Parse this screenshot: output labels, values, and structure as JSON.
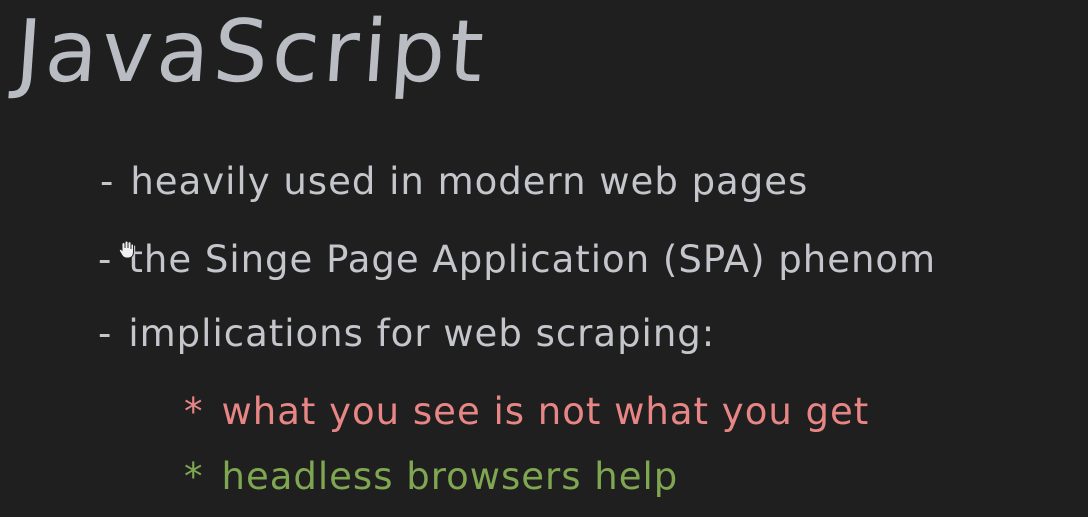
{
  "slide": {
    "title": "JavaScript",
    "bullets": [
      {
        "marker": "-",
        "text": "heavily used in modern web pages"
      },
      {
        "marker": "-",
        "text": "the Singe Page Application (SPA) phenom"
      },
      {
        "marker": "-",
        "text": "implications for web scraping:"
      }
    ],
    "sub_bullets": [
      {
        "marker": "*",
        "text": "what you see is not what you get",
        "color": "#e88585"
      },
      {
        "marker": "*",
        "text": "headless browsers help",
        "color": "#7fa651"
      }
    ]
  },
  "colors": {
    "background": "#1f1f1f",
    "title": "#b9bcc2",
    "bullet_text": "#c4c6cc"
  },
  "cursor": {
    "icon": "hand-grab-icon"
  }
}
